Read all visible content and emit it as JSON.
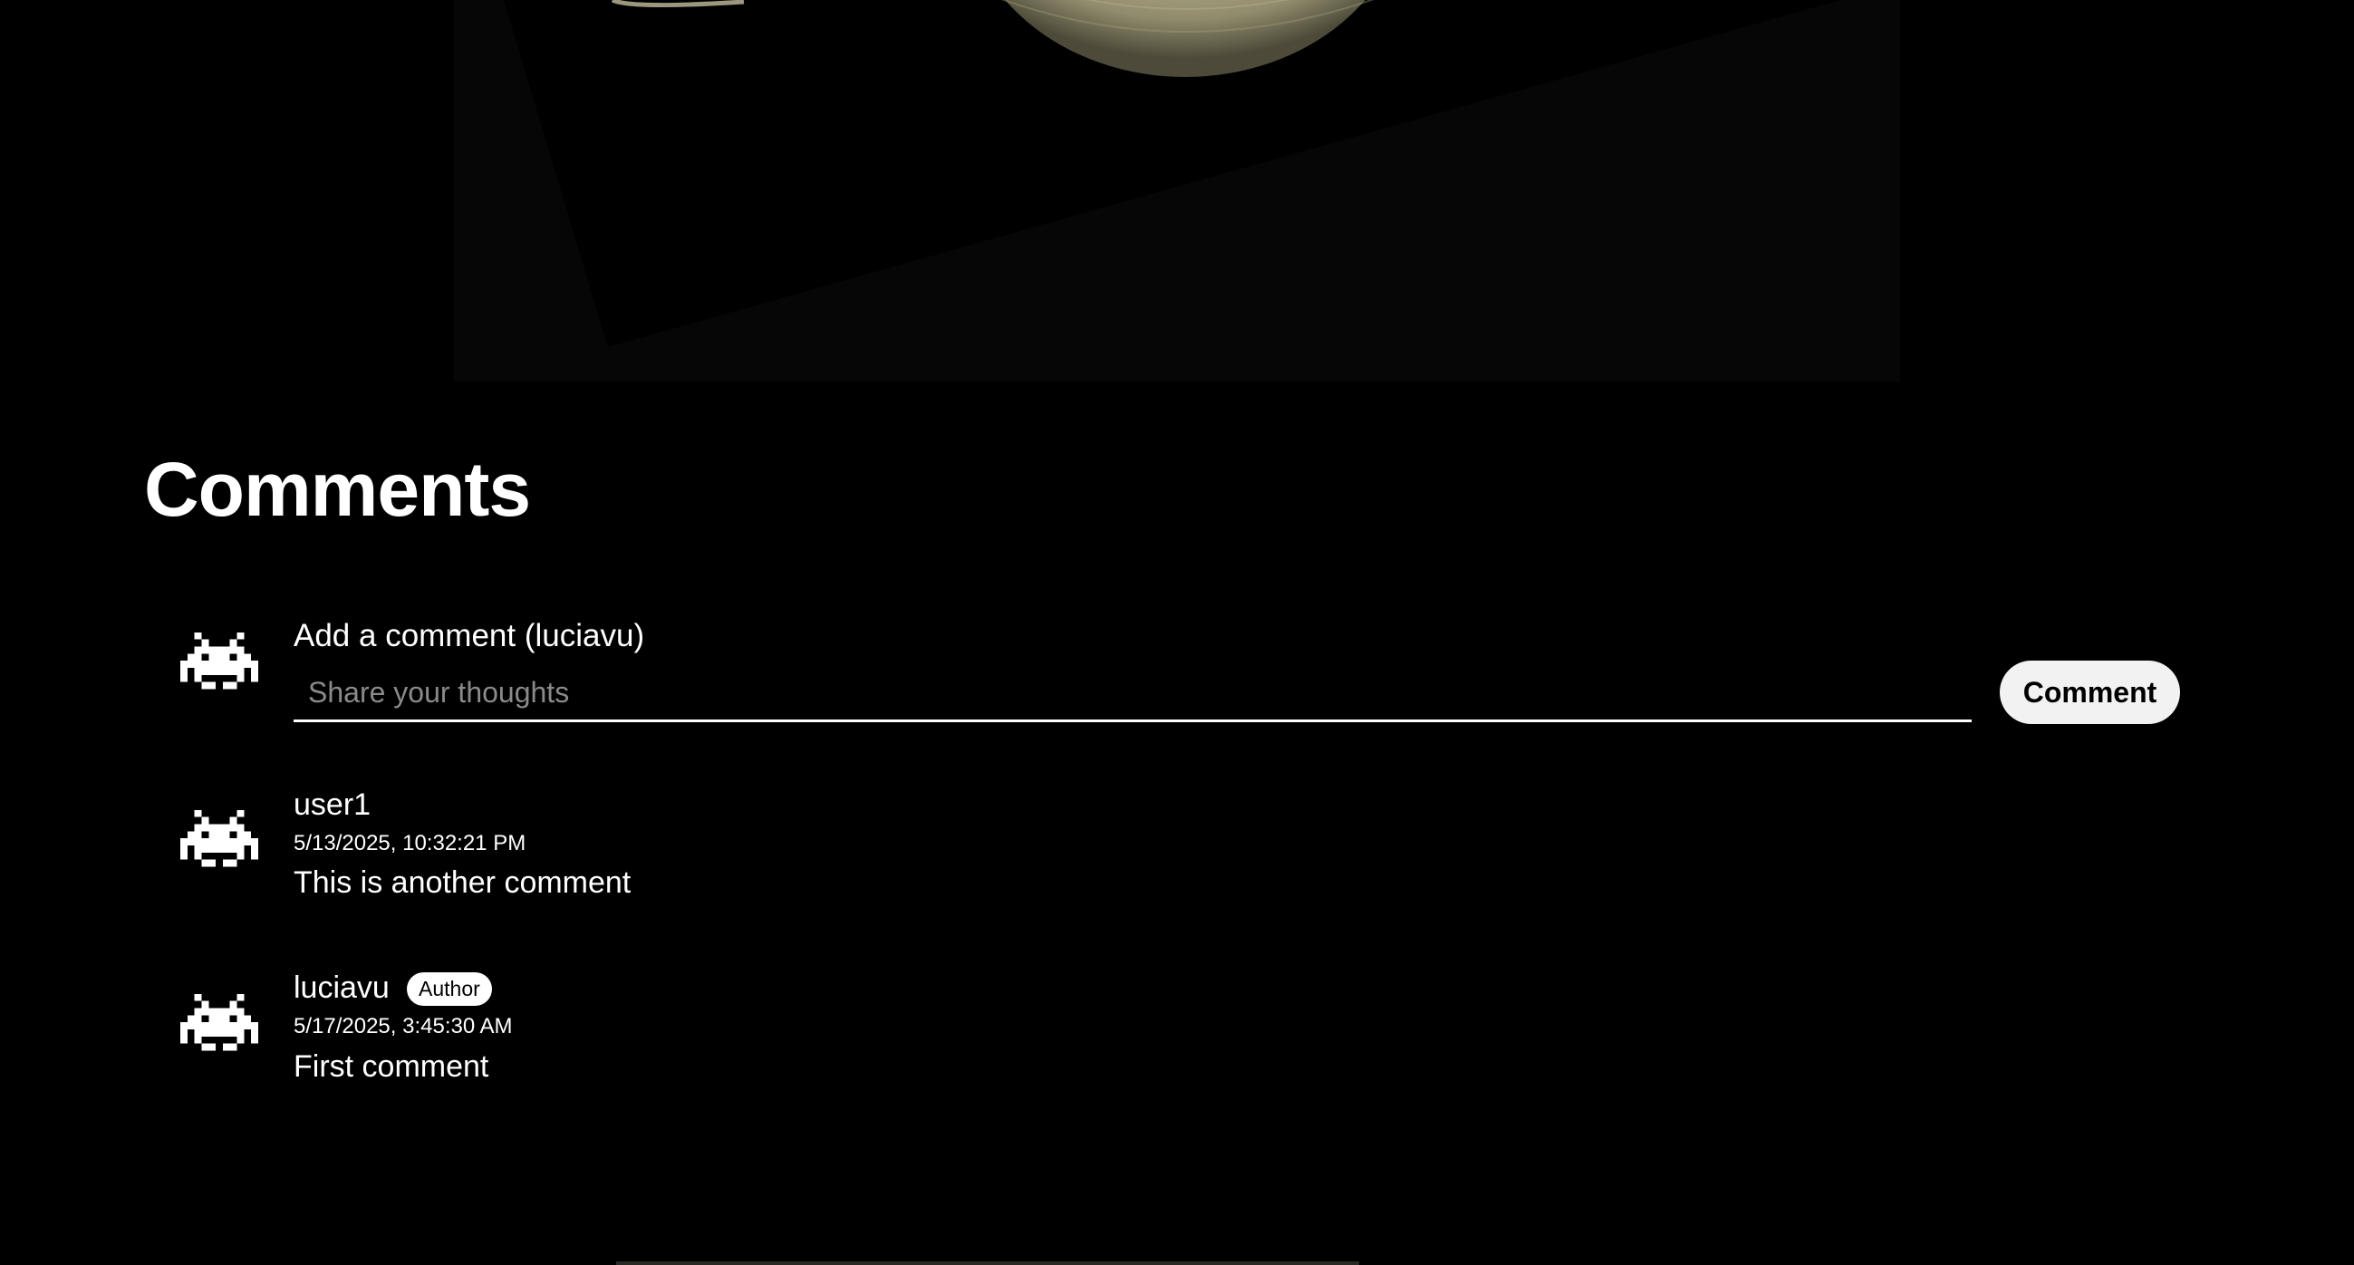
{
  "comments_section": {
    "heading": "Comments",
    "form": {
      "label": "Add a comment (luciavu)",
      "placeholder": "Share your thoughts",
      "value": "",
      "submit_label": "Comment",
      "avatar_icon": "space-invader-icon"
    },
    "items": [
      {
        "author": "user1",
        "timestamp": "5/13/2025, 10:32:21 PM",
        "text": "This is another comment",
        "avatar_icon": "space-invader-icon"
      },
      {
        "author": "luciavu",
        "badge": "Author",
        "timestamp": "5/17/2025, 3:45:30 AM",
        "text": "First comment",
        "avatar_icon": "space-invader-icon"
      }
    ]
  },
  "colors": {
    "background": "#000000",
    "text": "#ffffff",
    "button_bg": "#f2f2f2",
    "placeholder": "#8a8a8a"
  }
}
